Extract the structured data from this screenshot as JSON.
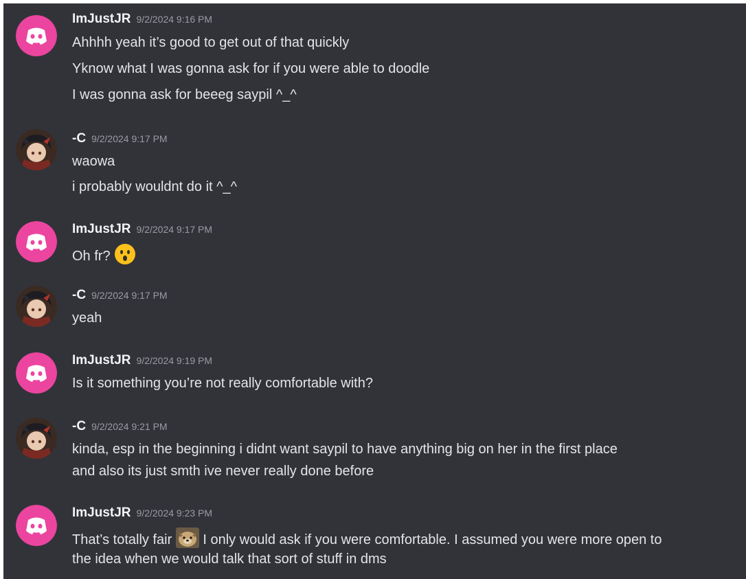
{
  "messages": [
    {
      "author": "ImJustJR",
      "timestamp": "9/2/2024 9:16 PM",
      "avatar": "discord-default-avatar-pink",
      "lines": [
        "Ahhhh yeah it’s good to get out of that quickly",
        "Yknow what I was gonna ask for if you were able to doodle",
        "I was gonna ask for beeeg saypil ^_^"
      ]
    },
    {
      "author": "-C",
      "timestamp": "9/2/2024 9:17 PM",
      "avatar": "anime-character-avatar",
      "lines": [
        "waowa",
        "i probably wouldnt do it ^_^"
      ]
    },
    {
      "author": "ImJustJR",
      "timestamp": "9/2/2024 9:17 PM",
      "avatar": "discord-default-avatar-pink",
      "lines": [
        "Oh fr?"
      ],
      "emoji": "hushed-face-emoji"
    },
    {
      "author": "-C",
      "timestamp": "9/2/2024 9:17 PM",
      "avatar": "anime-character-avatar",
      "lines": [
        "yeah"
      ]
    },
    {
      "author": "ImJustJR",
      "timestamp": "9/2/2024 9:19 PM",
      "avatar": "discord-default-avatar-pink",
      "lines": [
        "Is it something you’re not really comfortable with?"
      ]
    },
    {
      "author": "-C",
      "timestamp": "9/2/2024 9:21 PM",
      "avatar": "anime-character-avatar",
      "lines": [
        "kinda, esp in the beginning i didnt want saypil to have anything big on her in the first place",
        "and also its just smth ive never really done before"
      ]
    },
    {
      "author": "ImJustJR",
      "timestamp": "9/2/2024 9:23 PM",
      "avatar": "discord-default-avatar-pink",
      "lines": [
        "That’s totally fair",
        "I only would ask if you were comfortable. I assumed you were more open to",
        "the idea when we would talk that sort of stuff in dms"
      ],
      "emoji": "custom-dog-emoji"
    }
  ],
  "colors": {
    "background": "#323339",
    "username": "#f2f3f5",
    "timestamp": "#9a9ca3",
    "message_text": "#e3e5e8",
    "discord_avatar": "#eb459f"
  }
}
